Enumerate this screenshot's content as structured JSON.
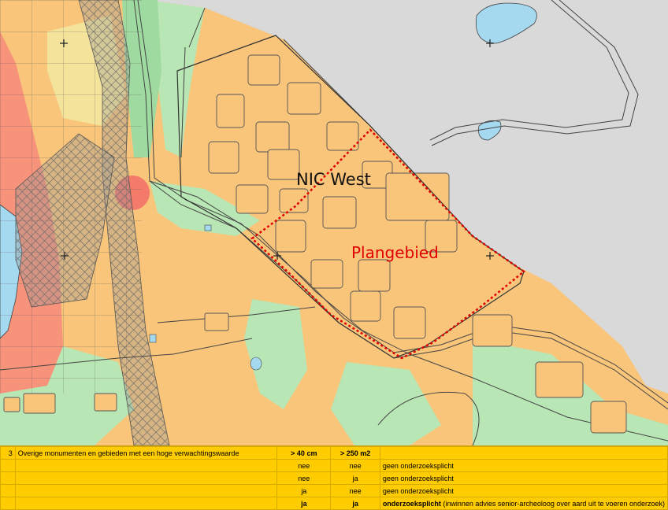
{
  "map": {
    "labels": {
      "nic_west": "NIC West",
      "plangebied": "Plangebied"
    },
    "colors": {
      "high_expectation": "#f9c57a",
      "low_expectation": "#f4e39a",
      "greenery": "#b8e6b4",
      "built_area": "#d9d9d9",
      "water": "#a5d9f0",
      "monument": "#f7937a",
      "plan_boundary": "#e00000"
    }
  },
  "legend": {
    "row_number": "3",
    "category": "Overige monumenten en gebieden met een hoge verwachtingswaarde",
    "col1_header": "> 40 cm",
    "col2_header": "> 250 m2",
    "rows": [
      {
        "c1": "nee",
        "c2": "nee",
        "text_bold": "",
        "text": "geen onderzoeksplicht"
      },
      {
        "c1": "nee",
        "c2": "ja",
        "text_bold": "",
        "text": "geen onderzoeksplicht"
      },
      {
        "c1": "ja",
        "c2": "nee",
        "text_bold": "",
        "text": "geen onderzoeksplicht"
      },
      {
        "c1": "ja",
        "c2": "ja",
        "text_bold": "onderzoeksplicht",
        "text": " (inwinnen advies senior-archeoloog over aard uit te voeren onderzoek)"
      }
    ]
  }
}
